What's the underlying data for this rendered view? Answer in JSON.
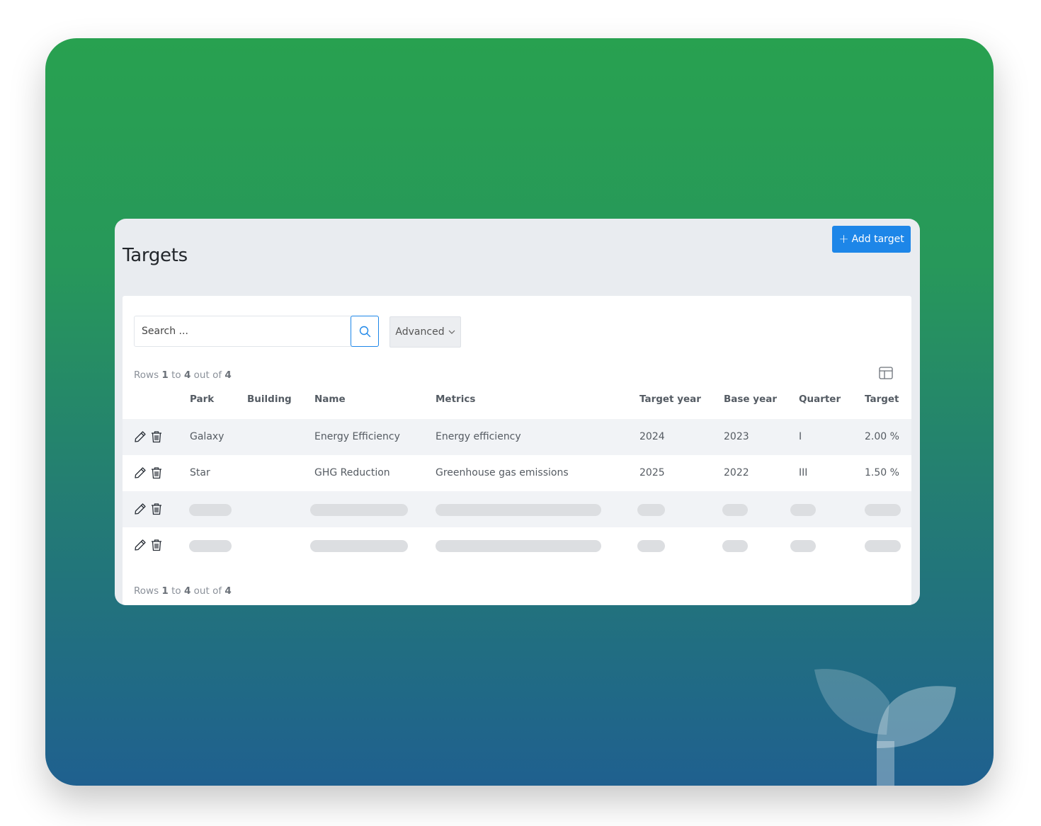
{
  "header": {
    "title": "Targets",
    "add_button_label": "Add target",
    "add_button_icon": "plus-icon"
  },
  "search": {
    "placeholder": "Search ...",
    "advanced_label": "Advanced"
  },
  "pagination": {
    "prefix": "Rows",
    "from": "1",
    "to_word": "to",
    "to": "4",
    "out_of_word": "out of",
    "total": "4"
  },
  "table": {
    "columns": [
      "Park",
      "Building",
      "Name",
      "Metrics",
      "Target year",
      "Base year",
      "Quarter",
      "Target"
    ],
    "rows": [
      {
        "park": "Galaxy",
        "building": "",
        "name": "Energy Efficiency",
        "metrics": "Energy efficiency",
        "target_year": "2024",
        "base_year": "2023",
        "quarter": "I",
        "target": "2.00 %"
      },
      {
        "park": "Star",
        "building": "",
        "name": "GHG Reduction",
        "metrics": "Greenhouse gas emissions",
        "target_year": "2025",
        "base_year": "2022",
        "quarter": "III",
        "target": "1.50 %"
      }
    ],
    "loading_rows": 2
  },
  "colors": {
    "accent": "#1d86e8",
    "gradient_top": "#28a150",
    "gradient_bottom": "#1f608f",
    "skeleton": "#dcdee1"
  }
}
